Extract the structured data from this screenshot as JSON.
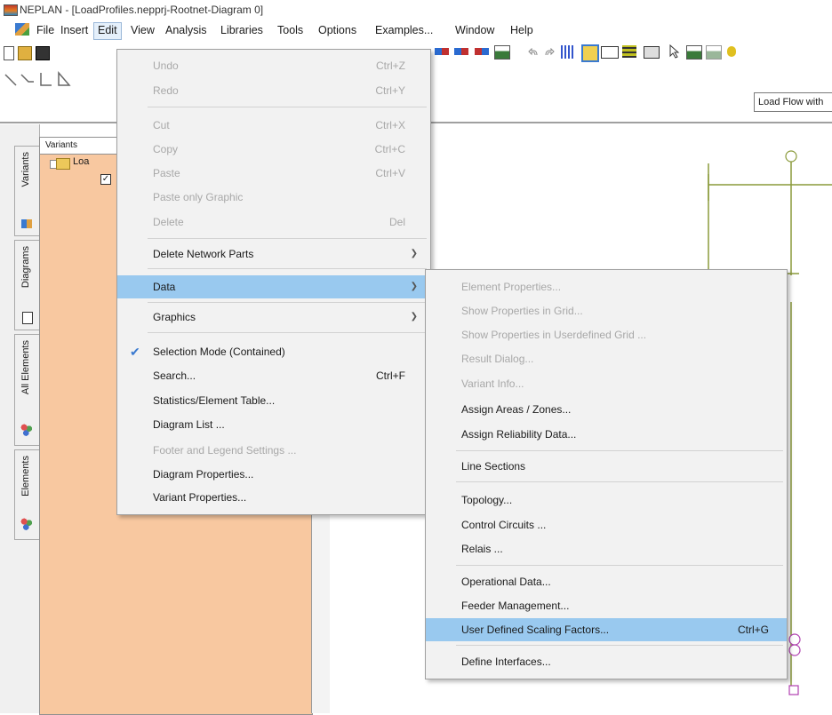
{
  "window": {
    "title": "NEPLAN - [LoadProfiles.nepprj-Rootnet-Diagram 0]"
  },
  "menubar": {
    "items": [
      {
        "label": "File"
      },
      {
        "label": "Insert"
      },
      {
        "label": "Edit"
      },
      {
        "label": "View"
      },
      {
        "label": "Analysis"
      },
      {
        "label": "Libraries"
      },
      {
        "label": "Tools"
      },
      {
        "label": "Options"
      },
      {
        "label": "Examples..."
      },
      {
        "label": "Window"
      },
      {
        "label": "Help"
      }
    ],
    "active_item": "Edit"
  },
  "toolbar": {
    "calc_mode_field": "Load Flow with"
  },
  "left_tabs": [
    {
      "label": "Variants"
    },
    {
      "label": "Diagrams"
    },
    {
      "label": "All Elements"
    },
    {
      "label": "Elements"
    }
  ],
  "variants_panel": {
    "header": "Variants",
    "tree_item": "Loa"
  },
  "edit_menu": {
    "items": [
      {
        "label": "Undo",
        "shortcut": "Ctrl+Z",
        "disabled": true
      },
      {
        "label": "Redo",
        "shortcut": "Ctrl+Y",
        "disabled": true
      },
      {
        "label": "Cut",
        "shortcut": "Ctrl+X",
        "disabled": true
      },
      {
        "label": "Copy",
        "shortcut": "Ctrl+C",
        "disabled": true
      },
      {
        "label": "Paste",
        "shortcut": "Ctrl+V",
        "disabled": true
      },
      {
        "label": "Paste only Graphic",
        "shortcut": "",
        "disabled": true
      },
      {
        "label": "Delete",
        "shortcut": "Del",
        "disabled": true
      },
      {
        "label": "Delete Network Parts",
        "shortcut": "",
        "submenu": true
      },
      {
        "label": "Data",
        "shortcut": "",
        "submenu": true,
        "highlighted": true
      },
      {
        "label": "Graphics",
        "shortcut": "",
        "submenu": true
      },
      {
        "label": "Selection Mode (Contained)",
        "shortcut": "",
        "checked": true
      },
      {
        "label": "Search...",
        "shortcut": "Ctrl+F"
      },
      {
        "label": "Statistics/Element Table..."
      },
      {
        "label": "Diagram List ..."
      },
      {
        "label": "Footer and Legend Settings ...",
        "disabled": true
      },
      {
        "label": "Diagram Properties..."
      },
      {
        "label": "Variant Properties..."
      }
    ]
  },
  "data_submenu": {
    "items": [
      {
        "label": "Element Properties...",
        "disabled": true
      },
      {
        "label": "Show Properties in Grid...",
        "disabled": true
      },
      {
        "label": "Show Properties in Userdefined Grid ...",
        "disabled": true
      },
      {
        "label": "Result Dialog...",
        "disabled": true
      },
      {
        "label": "Variant Info...",
        "disabled": true
      },
      {
        "label": "Assign Areas / Zones..."
      },
      {
        "label": "Assign Reliability Data..."
      },
      {
        "label": "Line Sections"
      },
      {
        "label": "Topology..."
      },
      {
        "label": "Control Circuits ..."
      },
      {
        "label": "Relais ..."
      },
      {
        "label": "Operational Data..."
      },
      {
        "label": "Feeder Management..."
      },
      {
        "label": "User Defined Scaling Factors...",
        "shortcut": "Ctrl+G",
        "highlighted": true
      },
      {
        "label": "Define Interfaces..."
      }
    ]
  },
  "colors": {
    "menu_highlight": "#99c9ef",
    "panel_bg": "#f8c8a0",
    "diagram_line": "#8a9a3a"
  }
}
